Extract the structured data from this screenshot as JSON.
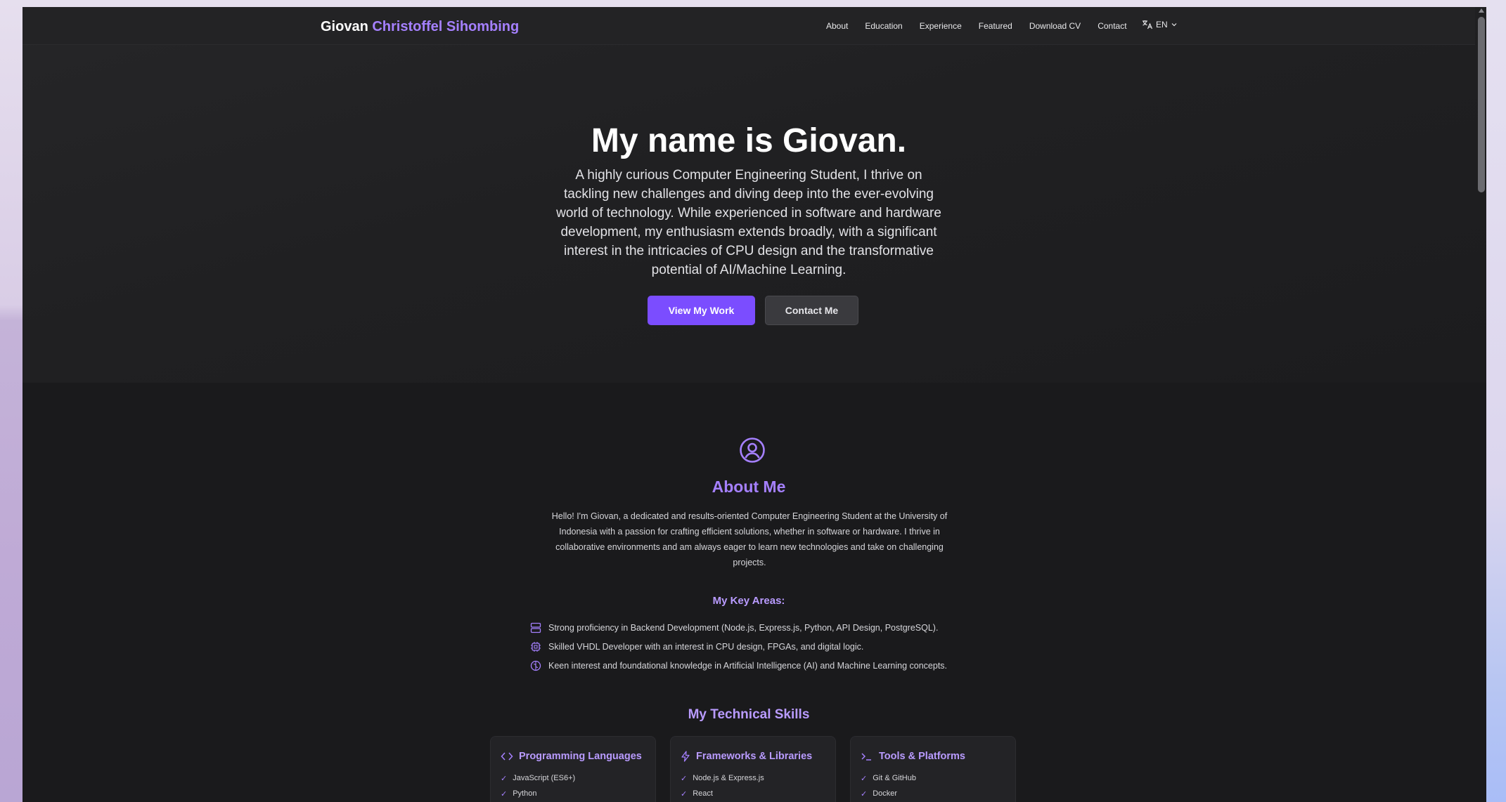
{
  "nav": {
    "brand_first": "Giovan",
    "brand_rest": "Christoffel Sihombing",
    "links": [
      "About",
      "Education",
      "Experience",
      "Featured",
      "Download CV",
      "Contact"
    ],
    "lang": "EN"
  },
  "hero": {
    "title": "My name is Giovan.",
    "text": "A highly curious Computer Engineering Student, I thrive on tackling new challenges and diving deep into the ever-evolving world of technology. While experienced in software and hardware development, my enthusiasm extends broadly, with a significant interest in the intricacies of CPU design and the transformative potential of AI/Machine Learning.",
    "primary_button": "View My Work",
    "secondary_button": "Contact Me"
  },
  "about": {
    "title": "About Me",
    "text": "Hello! I'm Giovan, a dedicated and results-oriented Computer Engineering Student at the University of Indonesia with a passion for crafting efficient solutions, whether in software or hardware. I thrive in collaborative environments and am always eager to learn new technologies and take on challenging projects.",
    "key_areas_title": "My Key Areas:",
    "key_areas": [
      "Strong proficiency in Backend Development (Node.js, Express.js, Python, API Design, PostgreSQL).",
      "Skilled VHDL Developer with an interest in CPU design, FPGAs, and digital logic.",
      "Keen interest and foundational knowledge in Artificial Intelligence (AI) and Machine Learning concepts."
    ],
    "skills_title": "My Technical Skills",
    "skills": [
      {
        "title": "Programming Languages",
        "items": [
          "JavaScript (ES6+)",
          "Python"
        ]
      },
      {
        "title": "Frameworks & Libraries",
        "items": [
          "Node.js & Express.js",
          "React"
        ]
      },
      {
        "title": "Tools & Platforms",
        "items": [
          "Git & GitHub",
          "Docker"
        ]
      }
    ]
  },
  "colors": {
    "accent": "#7b4dff",
    "accent_text": "#a580ff",
    "background": "#1a1a1c"
  }
}
